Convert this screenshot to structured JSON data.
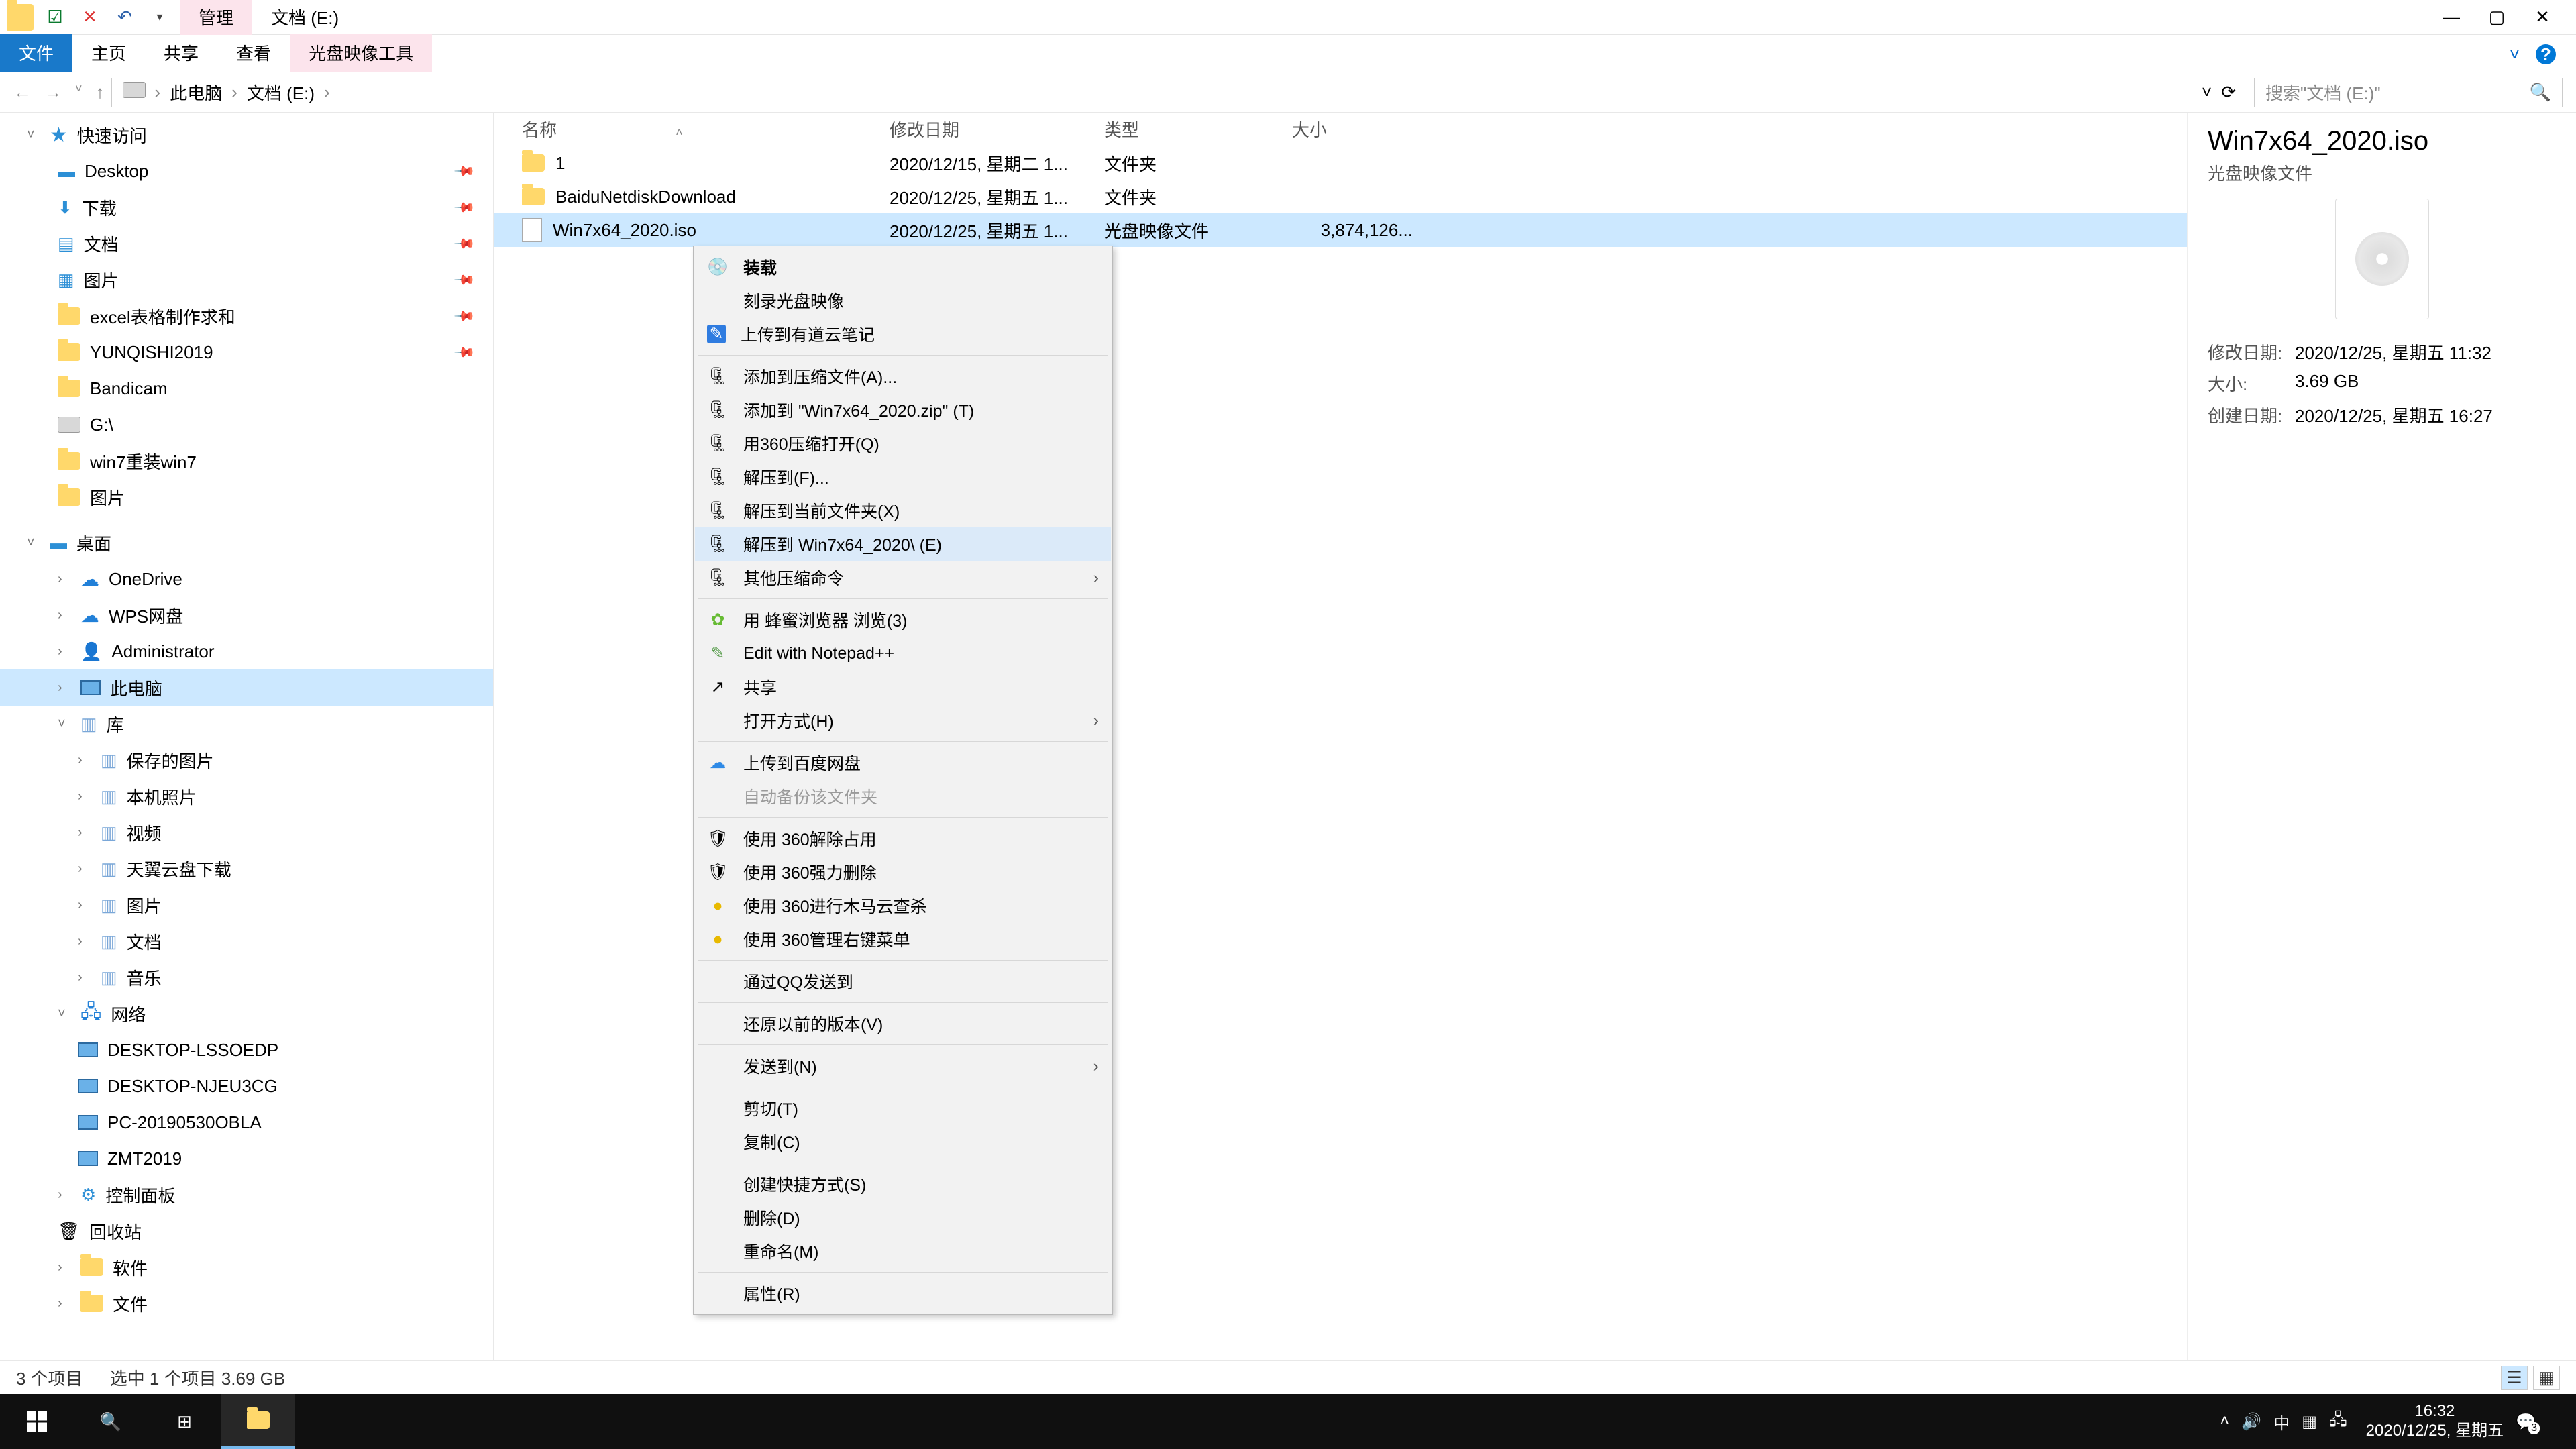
{
  "window": {
    "title_center": "文档 (E:)",
    "ribbon_context": "管理"
  },
  "ribbon_tabs": {
    "file": "文件",
    "home": "主页",
    "share": "共享",
    "view": "查看",
    "iso_tools": "光盘映像工具"
  },
  "address": {
    "root": "此电脑",
    "part2": "文档 (E:)",
    "search_placeholder": "搜索\"文档 (E:)\""
  },
  "tree": {
    "quick_access": "快速访问",
    "desktop": "Desktop",
    "downloads": "下载",
    "documents": "文档",
    "pictures": "图片",
    "excel": "excel表格制作求和",
    "yunqishi": "YUNQISHI2019",
    "bandicam": "Bandicam",
    "gdrive": "G:\\",
    "win7reinstall": "win7重装win7",
    "pictures2": "图片",
    "desktop_root": "桌面",
    "onedrive": "OneDrive",
    "wps": "WPS网盘",
    "admin": "Administrator",
    "thispc": "此电脑",
    "libraries": "库",
    "saved_pictures": "保存的图片",
    "camera_roll": "本机照片",
    "videos": "视频",
    "tianyi": "天翼云盘下载",
    "pictures3": "图片",
    "documents2": "文档",
    "music": "音乐",
    "network": "网络",
    "pc1": "DESKTOP-LSSOEDP",
    "pc2": "DESKTOP-NJEU3CG",
    "pc3": "PC-20190530OBLA",
    "pc4": "ZMT2019",
    "control_panel": "控制面板",
    "recycle": "回收站",
    "software": "软件",
    "files": "文件"
  },
  "columns": {
    "name": "名称",
    "date": "修改日期",
    "type": "类型",
    "size": "大小"
  },
  "rows": [
    {
      "icon": "folder",
      "name": "1",
      "date": "2020/12/15, 星期二 1...",
      "type": "文件夹",
      "size": ""
    },
    {
      "icon": "folder",
      "name": "BaiduNetdiskDownload",
      "date": "2020/12/25, 星期五 1...",
      "type": "文件夹",
      "size": ""
    },
    {
      "icon": "file",
      "name": "Win7x64_2020.iso",
      "date": "2020/12/25, 星期五 1...",
      "type": "光盘映像文件",
      "size": "3,874,126..."
    }
  ],
  "details": {
    "title": "Win7x64_2020.iso",
    "subtitle": "光盘映像文件",
    "mod_label": "修改日期:",
    "mod_val": "2020/12/25, 星期五 11:32",
    "size_label": "大小:",
    "size_val": "3.69 GB",
    "create_label": "创建日期:",
    "create_val": "2020/12/25, 星期五 16:27"
  },
  "ctx": {
    "mount": "装载",
    "burn": "刻录光盘映像",
    "youdao": "上传到有道云笔记",
    "add_archive": "添加到压缩文件(A)...",
    "add_zip": "添加到 \"Win7x64_2020.zip\" (T)",
    "open_360zip": "用360压缩打开(Q)",
    "extract_to": "解压到(F)...",
    "extract_here": "解压到当前文件夹(X)",
    "extract_named": "解压到 Win7x64_2020\\ (E)",
    "other_zip": "其他压缩命令",
    "bee_browser": "用 蜂蜜浏览器 浏览(3)",
    "notepadpp": "Edit with Notepad++",
    "share": "共享",
    "open_with": "打开方式(H)",
    "upload_baidu": "上传到百度网盘",
    "auto_backup": "自动备份该文件夹",
    "unlock_360": "使用 360解除占用",
    "delete_360": "使用 360强力删除",
    "scan_360": "使用 360进行木马云查杀",
    "manage_360": "使用 360管理右键菜单",
    "send_qq": "通过QQ发送到",
    "restore": "还原以前的版本(V)",
    "send_to": "发送到(N)",
    "cut": "剪切(T)",
    "copy": "复制(C)",
    "shortcut": "创建快捷方式(S)",
    "delete": "删除(D)",
    "rename": "重命名(M)",
    "properties": "属性(R)"
  },
  "status": {
    "items": "3 个项目",
    "selected": "选中 1 个项目  3.69 GB"
  },
  "taskbar": {
    "ime": "中",
    "time": "16:32",
    "date": "2020/12/25, 星期五",
    "badge": "3"
  }
}
